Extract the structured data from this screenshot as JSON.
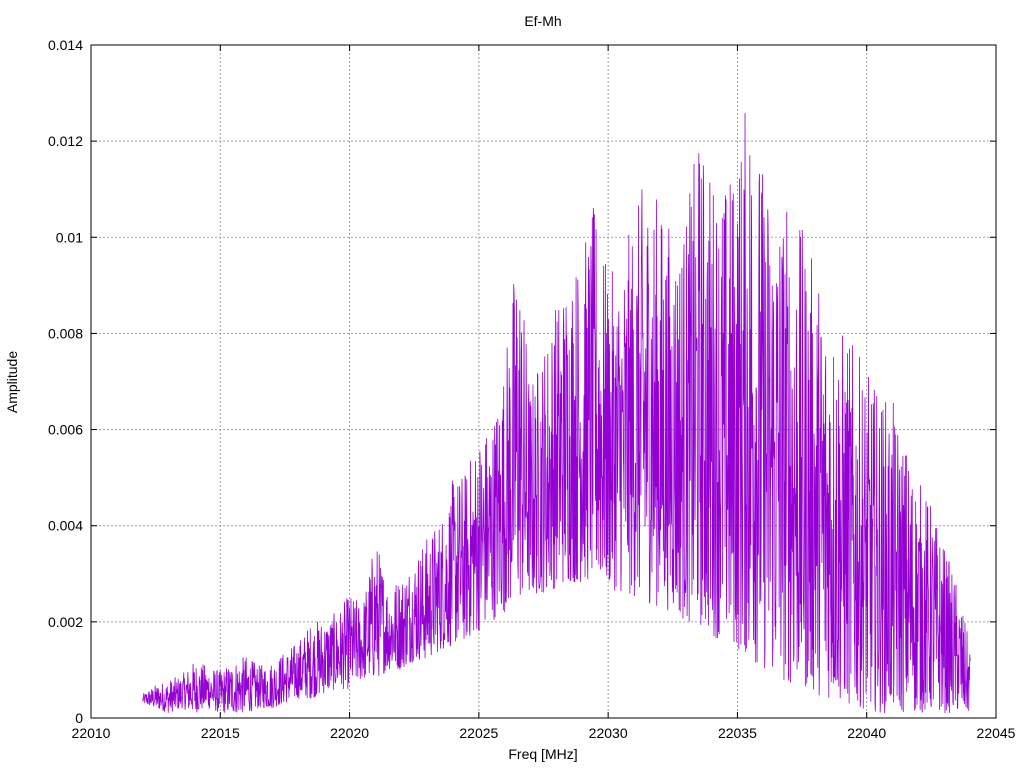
{
  "chart_data": {
    "type": "line",
    "title": "Ef-Mh",
    "xlabel": "Freq [MHz]",
    "ylabel": "Amplitude",
    "xlim": [
      22010,
      22045
    ],
    "ylim": [
      0,
      0.014
    ],
    "x_ticks": [
      "22010",
      "22015",
      "22020",
      "22025",
      "22030",
      "22035",
      "22040",
      "22045"
    ],
    "y_ticks": [
      "0",
      "0.002",
      "0.004",
      "0.006",
      "0.008",
      "0.01",
      "0.012",
      "0.014"
    ],
    "grid": true,
    "series": [
      {
        "color": "#9400d3",
        "x_start": 22012,
        "x_step": 0.5,
        "envelope_low": [
          0.0003,
          0.0002,
          0.0001,
          0.0002,
          0.0001,
          0.0002,
          0.0001,
          0.0001,
          0.0001,
          0.0002,
          0.0002,
          0.0003,
          0.0004,
          0.0004,
          0.0005,
          0.0006,
          0.0006,
          0.0008,
          0.0008,
          0.001,
          0.001,
          0.0012,
          0.0012,
          0.0014,
          0.0015,
          0.0016,
          0.0018,
          0.002,
          0.0022,
          0.0024,
          0.0025,
          0.0026,
          0.0027,
          0.0028,
          0.0028,
          0.0028,
          0.0027,
          0.0026,
          0.0025,
          0.0024,
          0.0023,
          0.0022,
          0.002,
          0.0019,
          0.0017,
          0.0016,
          0.0014,
          0.0012,
          0.001,
          0.0008,
          0.0007,
          0.0006,
          0.0005,
          0.0004,
          0.0003,
          0.0002,
          0.0002,
          0.0001,
          0.0001,
          0.0001,
          0.0001,
          0.0001,
          0.0001,
          0.0001,
          0.0001
        ],
        "envelope_high": [
          0.0005,
          0.0007,
          0.0008,
          0.0009,
          0.0012,
          0.0011,
          0.001,
          0.0012,
          0.0013,
          0.0011,
          0.0012,
          0.0014,
          0.0016,
          0.002,
          0.0021,
          0.0022,
          0.0026,
          0.0024,
          0.0038,
          0.0028,
          0.003,
          0.0034,
          0.0038,
          0.0042,
          0.005,
          0.0052,
          0.006,
          0.0062,
          0.0075,
          0.0101,
          0.007,
          0.0078,
          0.0088,
          0.0095,
          0.0098,
          0.0108,
          0.0092,
          0.0095,
          0.0105,
          0.0114,
          0.0108,
          0.0102,
          0.0105,
          0.0122,
          0.0115,
          0.0112,
          0.0118,
          0.0135,
          0.0115,
          0.0112,
          0.0108,
          0.0102,
          0.0095,
          0.0088,
          0.0082,
          0.0078,
          0.0072,
          0.0068,
          0.0066,
          0.0058,
          0.005,
          0.0045,
          0.0036,
          0.0028,
          0.0015
        ]
      }
    ]
  }
}
